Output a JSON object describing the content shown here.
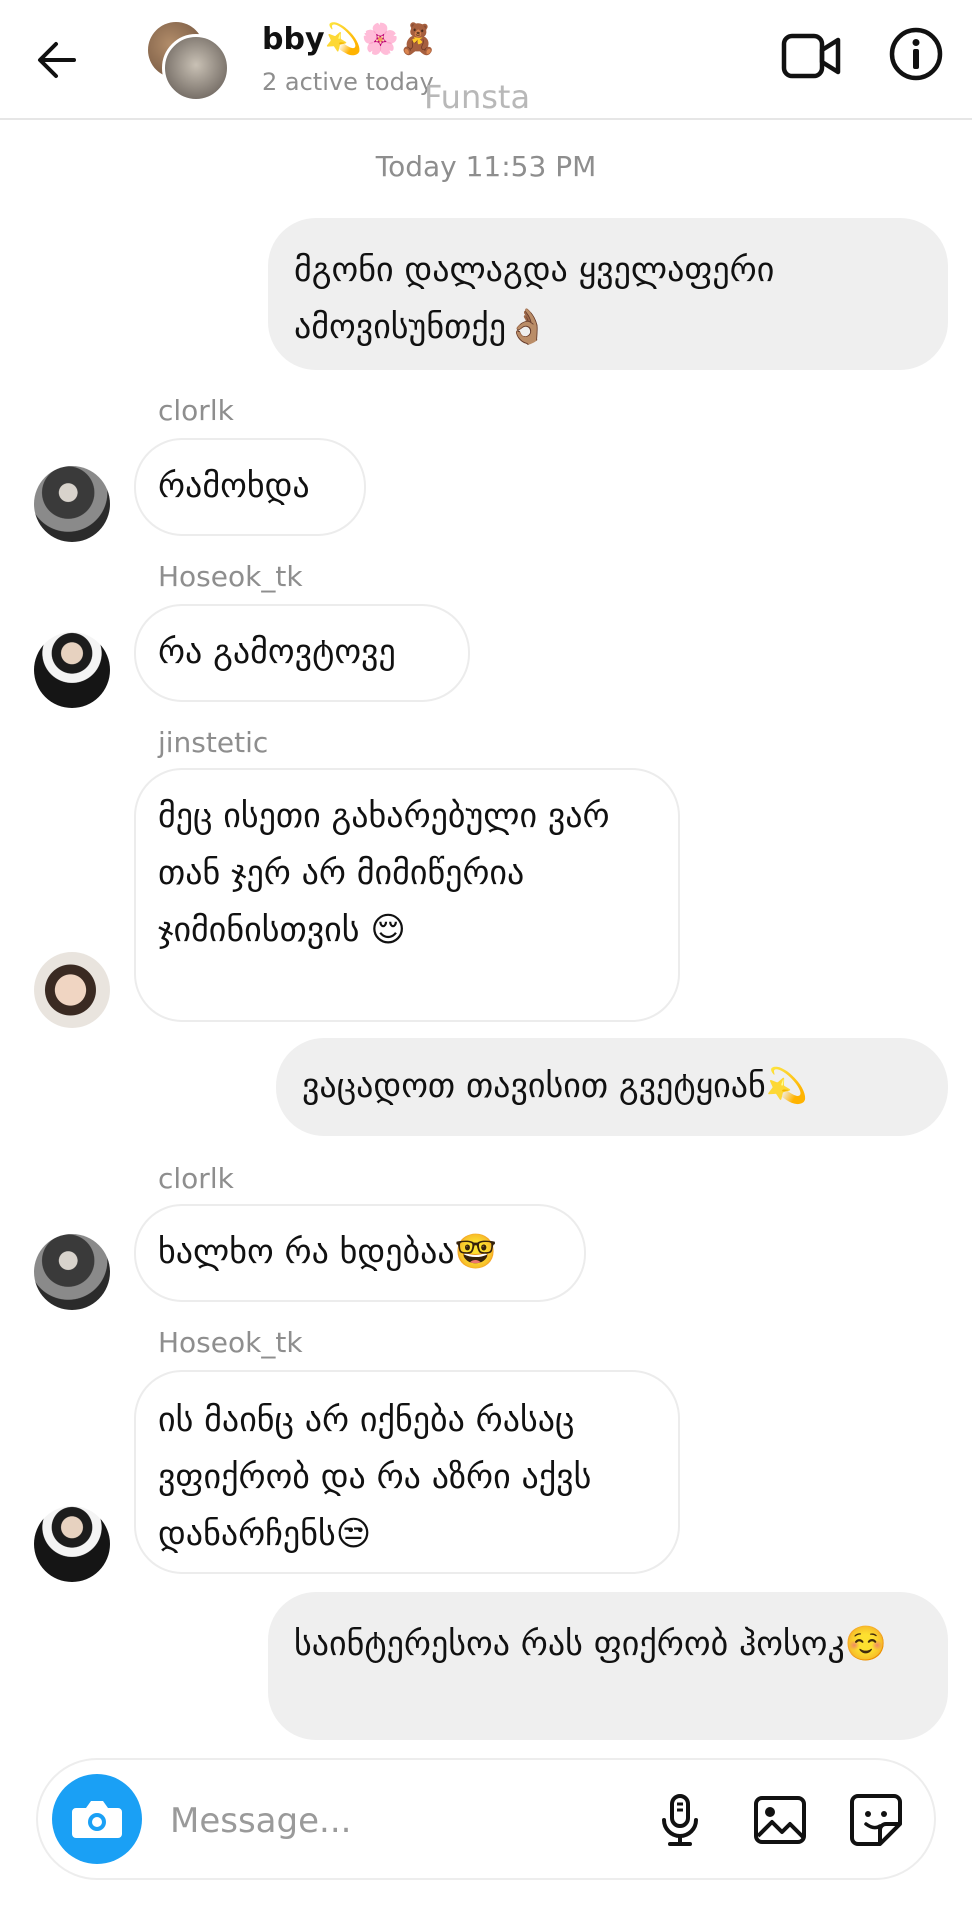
{
  "header": {
    "name": "bby💫🌸🧸",
    "status": "2 active today",
    "watermark": "Funsta"
  },
  "timestamp": "Today 11:53 PM",
  "messages": [
    {
      "dir": "out",
      "text": "მგონი დალაგდა ყველაფერი ამოვისუნთქე👌🏽"
    },
    {
      "dir": "in",
      "sender": "clorlk",
      "text": "რამოხდა"
    },
    {
      "dir": "in",
      "sender": "Hoseok_tk",
      "text": "რა გამოვტოვე"
    },
    {
      "dir": "in",
      "sender": "jinstetic",
      "text": "მეც ისეთი გახარებული ვარ თან ჯერ არ მიმიწერია ჯიმინისთვის 😌"
    },
    {
      "dir": "out",
      "text": "ვაცადოთ თავისით გვეტყიან💫"
    },
    {
      "dir": "in",
      "sender": "clorlk",
      "text": "ხალხო რა ხდებაა🤓"
    },
    {
      "dir": "in",
      "sender": "Hoseok_tk",
      "text": "ის მაინც არ იქნება რასაც ვფიქრობ და რა აზრი აქვს დანარჩენს😒"
    },
    {
      "dir": "out",
      "text": "საინტერესოა რას ფიქრობ ჰოსოკ☺️"
    }
  ],
  "composer": {
    "placeholder": "Message..."
  },
  "icons": {
    "back": "arrow-left-icon",
    "video": "video-camera-icon",
    "info": "info-icon",
    "camera": "camera-icon",
    "mic": "microphone-icon",
    "gallery": "image-icon",
    "sticker": "sticker-icon"
  },
  "colors": {
    "accent": "#1aa0f5",
    "outgoing_bubble": "#efefef",
    "meta_text": "#8e8e8e"
  }
}
